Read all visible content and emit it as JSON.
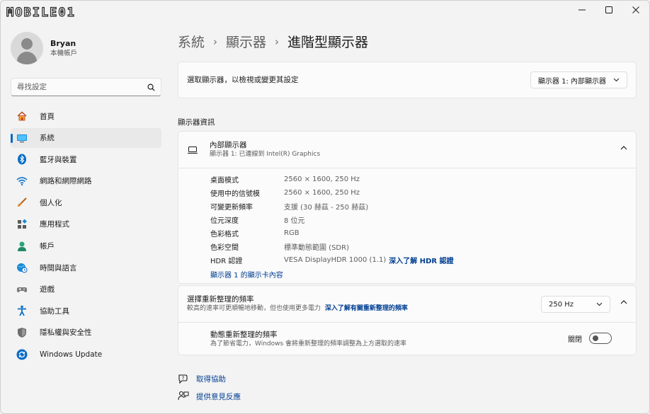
{
  "window": {
    "logo_text": "MOBILE01"
  },
  "profile": {
    "name": "Bryan",
    "account": "本機帳戶"
  },
  "search": {
    "placeholder": "尋找設定"
  },
  "nav": [
    {
      "label": "首頁",
      "icon": "home-icon"
    },
    {
      "label": "系統",
      "icon": "system-icon",
      "active": true
    },
    {
      "label": "藍牙與裝置",
      "icon": "bluetooth-icon"
    },
    {
      "label": "網路和網際網路",
      "icon": "wifi-icon"
    },
    {
      "label": "個人化",
      "icon": "brush-icon"
    },
    {
      "label": "應用程式",
      "icon": "apps-icon"
    },
    {
      "label": "帳戶",
      "icon": "accounts-icon"
    },
    {
      "label": "時間與語言",
      "icon": "globe-clock-icon"
    },
    {
      "label": "遊戲",
      "icon": "gamepad-icon"
    },
    {
      "label": "協助工具",
      "icon": "accessibility-icon"
    },
    {
      "label": "隱私權與安全性",
      "icon": "shield-icon"
    },
    {
      "label": "Windows Update",
      "icon": "update-icon"
    }
  ],
  "breadcrumb": [
    "系統",
    "顯示器",
    "進階型顯示器"
  ],
  "select_display": {
    "label": "選取顯示器，以檢視或變更其設定",
    "value": "顯示器 1: 內部顯示器"
  },
  "display_info": {
    "section_title": "顯示器資訊",
    "title": "內部顯示器",
    "subtitle": "顯示器 1: 已連線到 Intel(R) Graphics",
    "rows": [
      {
        "k": "桌面模式",
        "v": "2560 × 1600, 250 Hz"
      },
      {
        "k": "使用中的信號模",
        "v": "2560 × 1600, 250 Hz"
      },
      {
        "k": "可變更新頻率",
        "v": "支援 (30 赫茲 - 250 赫茲)"
      },
      {
        "k": "位元深度",
        "v": "8 位元"
      },
      {
        "k": "色彩格式",
        "v": "RGB"
      },
      {
        "k": "色彩空間",
        "v": "標準動態範圍 (SDR)"
      }
    ],
    "hdr_key": "HDR 認證",
    "hdr_value": "VESA DisplayHDR 1000 (1.1)",
    "hdr_link": "深入了解 HDR 認證",
    "adapter_link": "顯示器 1 的顯示卡內容"
  },
  "refresh": {
    "title": "選擇重新整理的頻率",
    "desc": "較高的速率可更順暢地移動，但也使用更多電力",
    "desc_link": "深入了解有關重新整理的頻率",
    "value": "250 Hz",
    "dynamic_title": "動態重新整理的頻率",
    "dynamic_desc": "為了節省電力，Windows 會將重新整理的頻率調整為上方選取的速率",
    "toggle_label": "關閉",
    "toggle_on": false
  },
  "help": {
    "get_help": "取得協助",
    "feedback": "提供意見反應"
  },
  "colors": {
    "accent": "#0067c0",
    "link": "#003e92"
  }
}
